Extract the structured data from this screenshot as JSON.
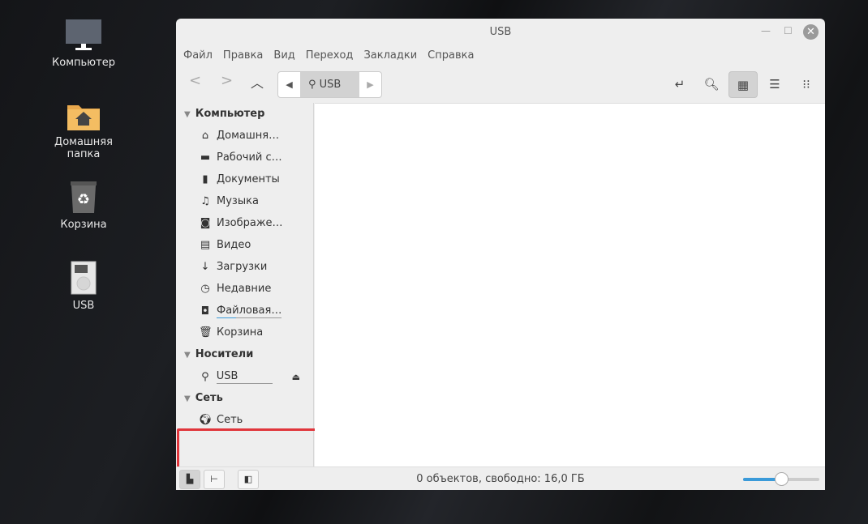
{
  "desktop": {
    "icons": [
      {
        "label": "Компьютер"
      },
      {
        "label": "Домашняя папка"
      },
      {
        "label": "Корзина"
      },
      {
        "label": "USB"
      }
    ]
  },
  "window": {
    "title": "USB",
    "close_glyph": "✕"
  },
  "menu": [
    "Файл",
    "Правка",
    "Вид",
    "Переход",
    "Закладки",
    "Справка"
  ],
  "path": {
    "current": "USB"
  },
  "sidebar": {
    "computer": {
      "header": "Компьютер",
      "items": [
        {
          "label": "Домашня…",
          "icon": "home-icon"
        },
        {
          "label": "Рабочий с…",
          "icon": "desktop-icon"
        },
        {
          "label": "Документы",
          "icon": "document-icon"
        },
        {
          "label": "Музыка",
          "icon": "music-icon"
        },
        {
          "label": "Изображе…",
          "icon": "camera-icon"
        },
        {
          "label": "Видео",
          "icon": "film-icon"
        },
        {
          "label": "Загрузки",
          "icon": "download-icon"
        },
        {
          "label": "Недавние",
          "icon": "clock-icon"
        },
        {
          "label": "Файловая…",
          "icon": "drive-icon",
          "usage": 0.3
        },
        {
          "label": "Корзина",
          "icon": "trash-icon"
        }
      ]
    },
    "devices": {
      "header": "Носители",
      "items": [
        {
          "label": "USB",
          "icon": "usb-icon"
        }
      ]
    },
    "network": {
      "header": "Сеть",
      "items": [
        {
          "label": "Сеть",
          "icon": "globe-icon"
        }
      ]
    }
  },
  "status": {
    "text": "0 объектов, свободно: 16,0 ГБ",
    "zoom_fraction": 0.5
  },
  "colors": {
    "highlight": "#e0353b",
    "accent": "#3a9ad9"
  }
}
